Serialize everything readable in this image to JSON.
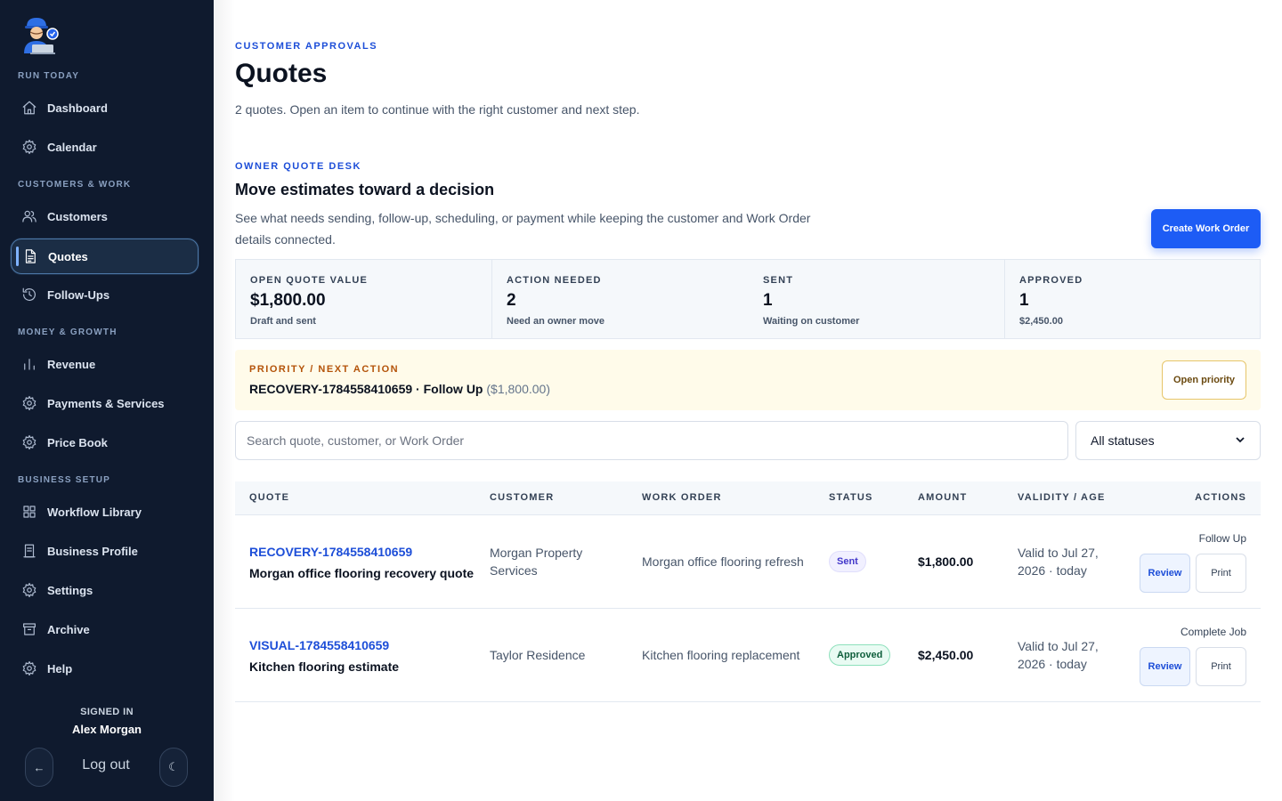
{
  "sidebar": {
    "sections": [
      {
        "label": "RUN TODAY"
      },
      {
        "label": "CUSTOMERS & WORK"
      },
      {
        "label": "MONEY & GROWTH"
      },
      {
        "label": "BUSINESS SETUP"
      }
    ],
    "items": [
      {
        "label": "Dashboard",
        "icon": "home-icon"
      },
      {
        "label": "Calendar",
        "icon": "gear-icon"
      },
      {
        "label": "Customers",
        "icon": "users-icon"
      },
      {
        "label": "Quotes",
        "icon": "document-icon",
        "active": true
      },
      {
        "label": "Follow-Ups",
        "icon": "history-icon"
      },
      {
        "label": "Revenue",
        "icon": "bar-chart-icon"
      },
      {
        "label": "Payments & Services",
        "icon": "gear-icon"
      },
      {
        "label": "Price Book",
        "icon": "gear-icon"
      },
      {
        "label": "Workflow Library",
        "icon": "grid-icon"
      },
      {
        "label": "Business Profile",
        "icon": "profile-doc-icon"
      },
      {
        "label": "Settings",
        "icon": "gear-icon"
      },
      {
        "label": "Archive",
        "icon": "archive-icon"
      },
      {
        "label": "Help",
        "icon": "gear-icon"
      }
    ],
    "signed_in_label": "SIGNED IN",
    "user_name": "Alex Morgan",
    "back_glyph": "←",
    "logout_label": "Log out",
    "theme_glyph": "☾"
  },
  "header": {
    "eyebrow": "CUSTOMER APPROVALS",
    "title": "Quotes",
    "subtitle": "2 quotes. Open an item to continue with the right customer and next step."
  },
  "desk": {
    "eyebrow": "OWNER QUOTE DESK",
    "title": "Move estimates toward a decision",
    "description": "See what needs sending, follow-up, scheduling, or payment while keeping the customer and Work Order details connected.",
    "create_label": "Create Work Order"
  },
  "stats": [
    {
      "label": "OPEN QUOTE VALUE",
      "value": "$1,800.00",
      "sub": "Draft and sent"
    },
    {
      "label": "ACTION NEEDED",
      "value": "2",
      "sub": "Need an owner move"
    },
    {
      "label": "SENT",
      "value": "1",
      "sub": "Waiting on customer"
    },
    {
      "label": "APPROVED",
      "value": "1",
      "sub": "$2,450.00"
    }
  ],
  "priority": {
    "label": "PRIORITY / NEXT ACTION",
    "text": "RECOVERY-1784558410659 · Follow Up",
    "amount": "($1,800.00)",
    "button_label": "Open priority"
  },
  "filters": {
    "search_placeholder": "Search quote, customer, or Work Order",
    "status_value": "All statuses"
  },
  "table": {
    "headers": [
      "QUOTE",
      "CUSTOMER",
      "WORK ORDER",
      "STATUS",
      "AMOUNT",
      "VALIDITY / AGE",
      "ACTIONS"
    ],
    "rows": [
      {
        "id": "RECOVERY-1784558410659",
        "name": "Morgan office flooring recovery quote",
        "customer": "Morgan Property Services",
        "work_order": "Morgan office flooring refresh",
        "status": "Sent",
        "amount": "$1,800.00",
        "validity": "Valid to Jul 27, 2026 · today",
        "next_step": "Follow Up",
        "review_label": "Review",
        "print_label": "Print"
      },
      {
        "id": "VISUAL-1784558410659",
        "name": "Kitchen flooring estimate",
        "customer": "Taylor Residence",
        "work_order": "Kitchen flooring replacement",
        "status": "Approved",
        "amount": "$2,450.00",
        "validity": "Valid to Jul 27, 2026 · today",
        "next_step": "Complete Job",
        "review_label": "Review",
        "print_label": "Print"
      }
    ]
  }
}
